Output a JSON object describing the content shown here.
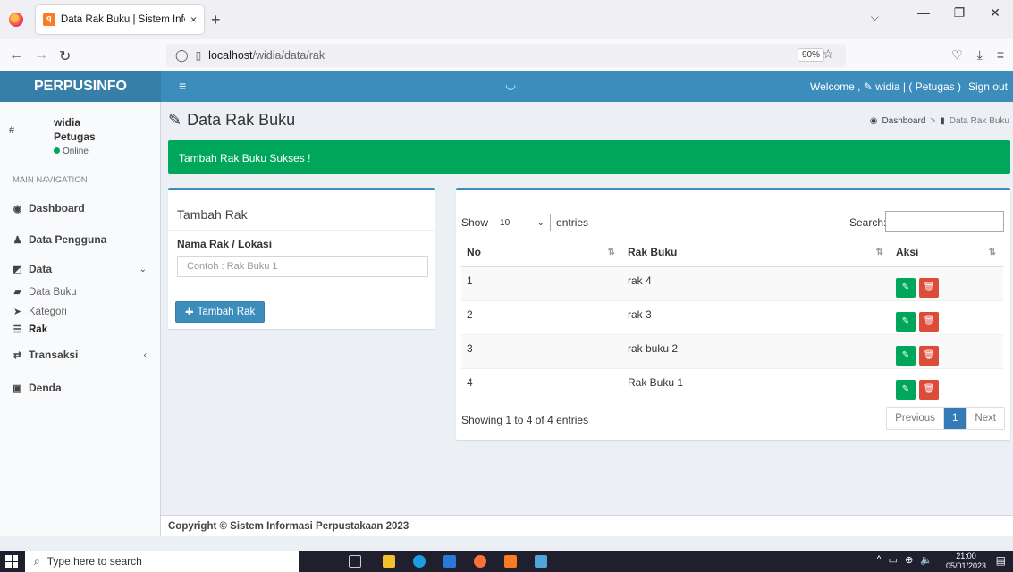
{
  "browser": {
    "tab_title": "Data Rak Buku | Sistem Informa",
    "tab_close": "×",
    "new_tab": "+",
    "url_host": "localhost",
    "url_path": "/widia/data/rak",
    "zoom": "90%"
  },
  "header": {
    "logo": "PERPUSINFO",
    "welcome": "Welcome , ✎ widia | ( Petugas )",
    "signout": "Sign out"
  },
  "sidebar": {
    "hash": "#",
    "user_name": "widia",
    "user_role": "Petugas",
    "user_status": "Online",
    "menu_header": "MAIN NAVIGATION",
    "items": [
      {
        "label": "Dashboard"
      },
      {
        "label": "Data Pengguna"
      },
      {
        "label": "Data"
      },
      {
        "label": "Data Buku"
      },
      {
        "label": "Kategori"
      },
      {
        "label": "Rak"
      },
      {
        "label": "Transaksi"
      },
      {
        "label": "Denda"
      }
    ]
  },
  "content": {
    "title": "Data Rak Buku",
    "breadcrumb": [
      "Dashboard",
      ">",
      "Data Rak Buku"
    ],
    "alert": "Tambah Rak Buku Sukses !"
  },
  "form": {
    "title": "Tambah Rak",
    "label": "Nama Rak / Lokasi",
    "placeholder": "Contoh : Rak Buku 1",
    "button": "Tambah Rak"
  },
  "table": {
    "show": "Show",
    "entries_value": "10",
    "entries": "entries",
    "search": "Search:",
    "columns": [
      "No",
      "Rak Buku",
      "Aksi"
    ],
    "rows": [
      {
        "no": "1",
        "rak": "rak 4"
      },
      {
        "no": "2",
        "rak": "rak 3"
      },
      {
        "no": "3",
        "rak": "rak buku 2"
      },
      {
        "no": "4",
        "rak": "Rak Buku 1"
      }
    ],
    "info": "Showing 1 to 4 of 4 entries",
    "pager": {
      "prev": "Previous",
      "current": "1",
      "next": "Next"
    }
  },
  "footer": {
    "text": "Copyright © Sistem Informasi Perpustakaan 2023"
  },
  "taskbar": {
    "search": "Type here to search",
    "time": "21:00",
    "date": "05/01/2023"
  },
  "colors": {
    "primary": "#3c8dbc",
    "success": "#00a65a",
    "danger": "#dd4b39"
  }
}
